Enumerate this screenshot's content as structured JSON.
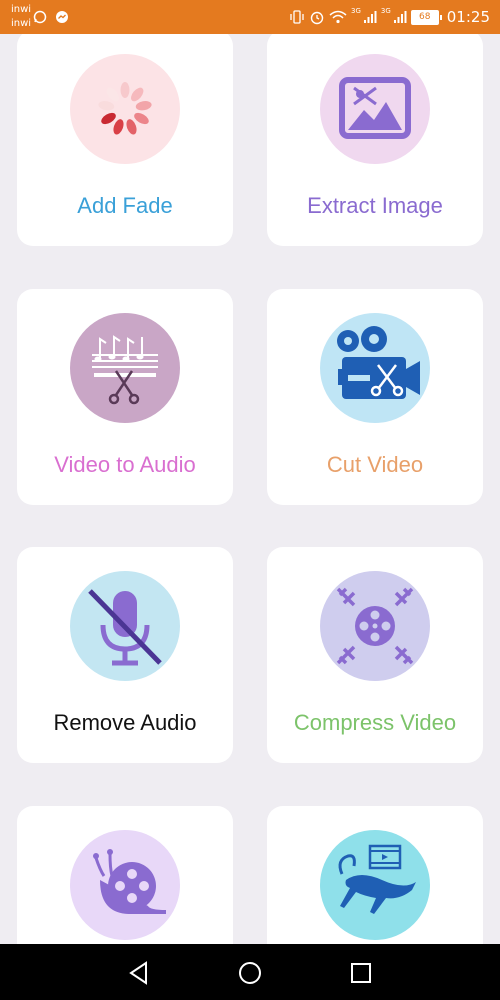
{
  "status_bar": {
    "carrier_1": "inwi",
    "carrier_2": "inwi",
    "time": "01:25",
    "battery": "68",
    "network_1": "3G",
    "network_2": "3G",
    "bg_color": "#e47a1f"
  },
  "tools": [
    {
      "label": "Add Fade",
      "color": "#3aa0d8",
      "icon": "fade-icon"
    },
    {
      "label": "Extract Image",
      "color": "#8a6bd0",
      "icon": "image-icon"
    },
    {
      "label": "Video to Audio",
      "color": "#d96fd0",
      "icon": "music-cut-icon"
    },
    {
      "label": "Cut Video",
      "color": "#e8a06a",
      "icon": "film-camera-icon"
    },
    {
      "label": "Remove Audio",
      "color": "#111111",
      "icon": "mic-off-icon"
    },
    {
      "label": "Compress Video",
      "color": "#7cc36a",
      "icon": "compress-icon"
    },
    {
      "label": "",
      "color": "#8a6bd0",
      "icon": "slow-motion-icon"
    },
    {
      "label": "",
      "color": "#3aa0d8",
      "icon": "fast-motion-icon"
    }
  ],
  "nav": {
    "back": "back-icon",
    "home": "home-icon",
    "recents": "recents-icon"
  }
}
